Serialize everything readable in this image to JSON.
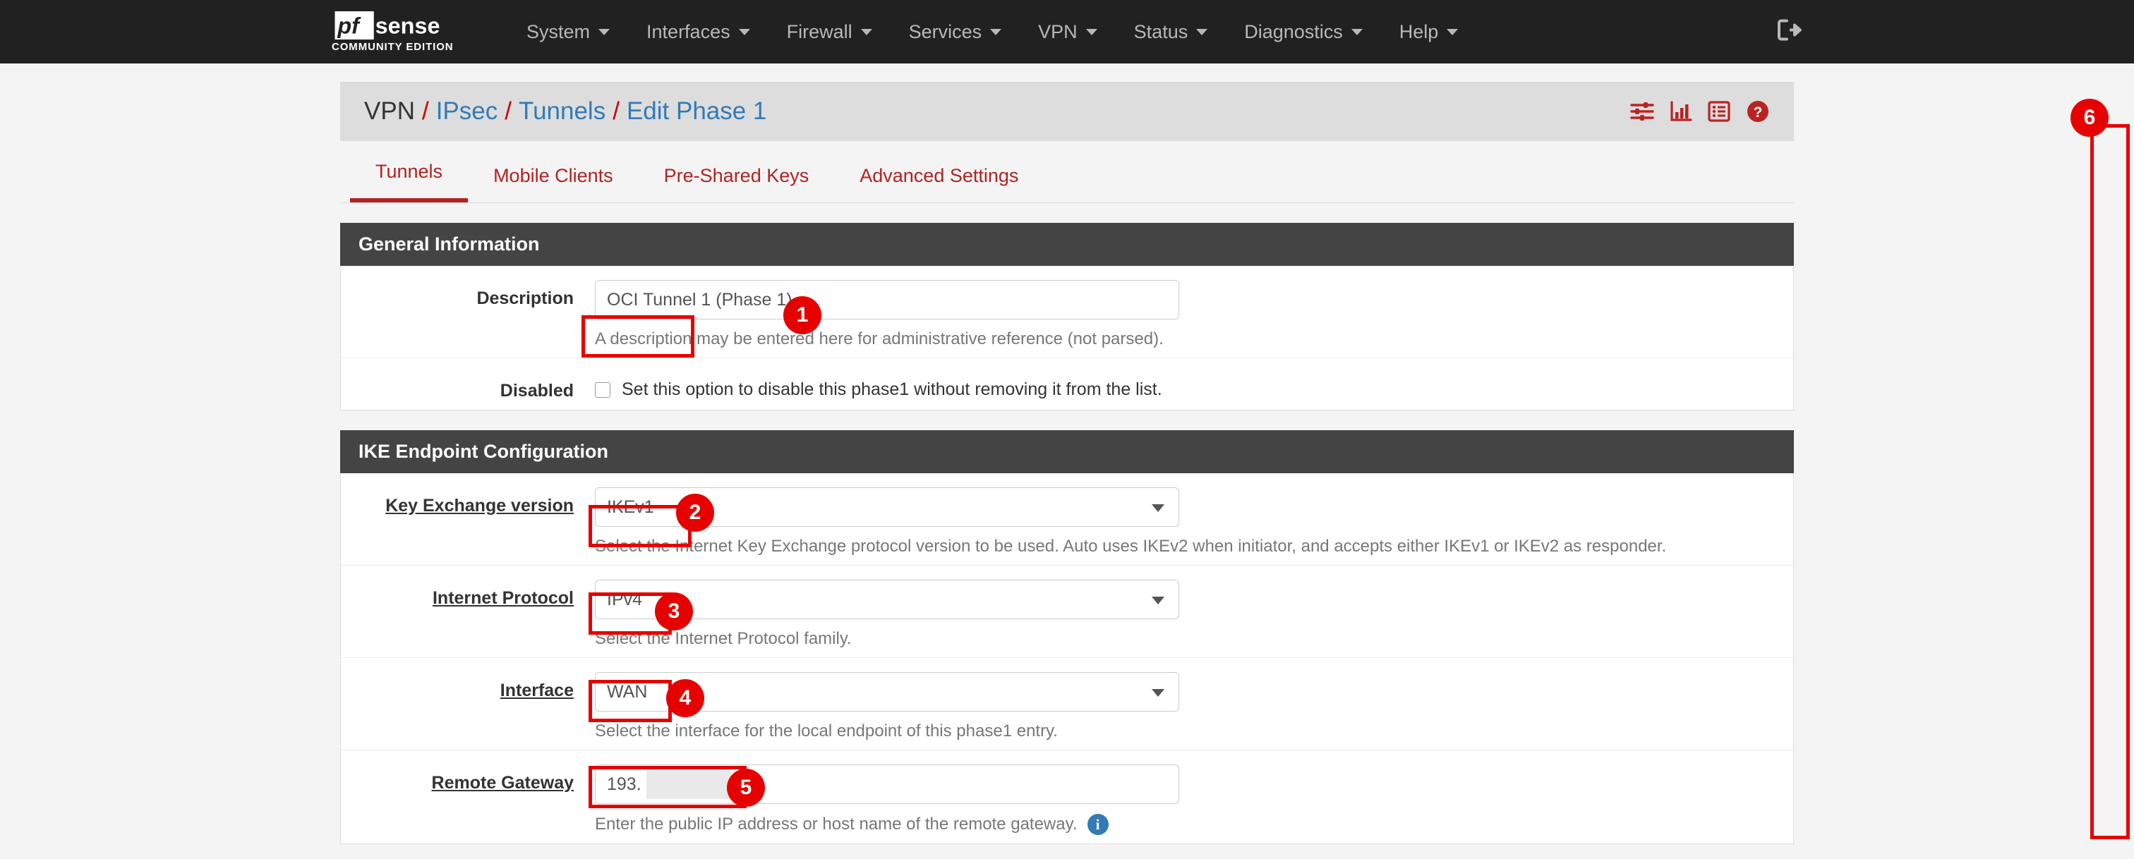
{
  "navbar": {
    "brand_name": "pfsense",
    "brand_subtitle": "COMMUNITY EDITION",
    "items": [
      {
        "label": "System",
        "icon": "chevron-down-icon"
      },
      {
        "label": "Interfaces",
        "icon": "chevron-down-icon"
      },
      {
        "label": "Firewall",
        "icon": "chevron-down-icon"
      },
      {
        "label": "Services",
        "icon": "chevron-down-icon"
      },
      {
        "label": "VPN",
        "icon": "chevron-down-icon"
      },
      {
        "label": "Status",
        "icon": "chevron-down-icon"
      },
      {
        "label": "Diagnostics",
        "icon": "chevron-down-icon"
      },
      {
        "label": "Help",
        "icon": "chevron-down-icon"
      }
    ],
    "logout_icon": "sign-out-icon"
  },
  "breadcrumb": {
    "root": "VPN",
    "sep": "/",
    "level2": "IPsec",
    "level3": "Tunnels",
    "current": "Edit Phase 1",
    "icons": [
      {
        "name": "sliders-icon"
      },
      {
        "name": "bar-chart-icon"
      },
      {
        "name": "list-icon"
      },
      {
        "name": "help-circle-icon"
      }
    ]
  },
  "tabs": [
    {
      "label": "Tunnels",
      "active": true
    },
    {
      "label": "Mobile Clients",
      "active": false
    },
    {
      "label": "Pre-Shared Keys",
      "active": false
    },
    {
      "label": "Advanced Settings",
      "active": false
    }
  ],
  "general_information": {
    "title": "General Information",
    "description": {
      "label": "Description",
      "value": "OCI Tunnel 1 (Phase 1)",
      "help": "A description may be entered here for administrative reference (not parsed)."
    },
    "disabled": {
      "label": "Disabled",
      "checkbox_label": "Set this option to disable this phase1 without removing it from the list.",
      "checked": false
    }
  },
  "ike_endpoint_configuration": {
    "title": "IKE Endpoint Configuration",
    "key_exchange_version": {
      "label": "Key Exchange version",
      "value": "IKEv1",
      "help": "Select the Internet Key Exchange protocol version to be used. Auto uses IKEv2 when initiator, and accepts either IKEv1 or IKEv2 as responder."
    },
    "internet_protocol": {
      "label": "Internet Protocol",
      "value": "IPv4",
      "help": "Select the Internet Protocol family."
    },
    "interface": {
      "label": "Interface",
      "value": "WAN",
      "help": "Select the interface for the local endpoint of this phase1 entry."
    },
    "remote_gateway": {
      "label": "Remote Gateway",
      "value": "193.",
      "help": "Enter the public IP address or host name of the remote gateway.",
      "info_icon": "info-icon"
    }
  },
  "annotations": {
    "accent_color": "#e60000",
    "badges": [
      {
        "number": "1",
        "target": "description-input"
      },
      {
        "number": "2",
        "target": "key-exchange-version-select"
      },
      {
        "number": "3",
        "target": "internet-protocol-select"
      },
      {
        "number": "4",
        "target": "interface-select"
      },
      {
        "number": "5",
        "target": "remote-gateway-input"
      },
      {
        "number": "6",
        "target": "page-scrollbar"
      }
    ]
  },
  "colors": {
    "navbar_bg": "#212121",
    "page_bg": "#f4f4f4",
    "panel_header_bg": "#444444",
    "brand_red": "#b22222",
    "link_blue": "#337ab7"
  }
}
